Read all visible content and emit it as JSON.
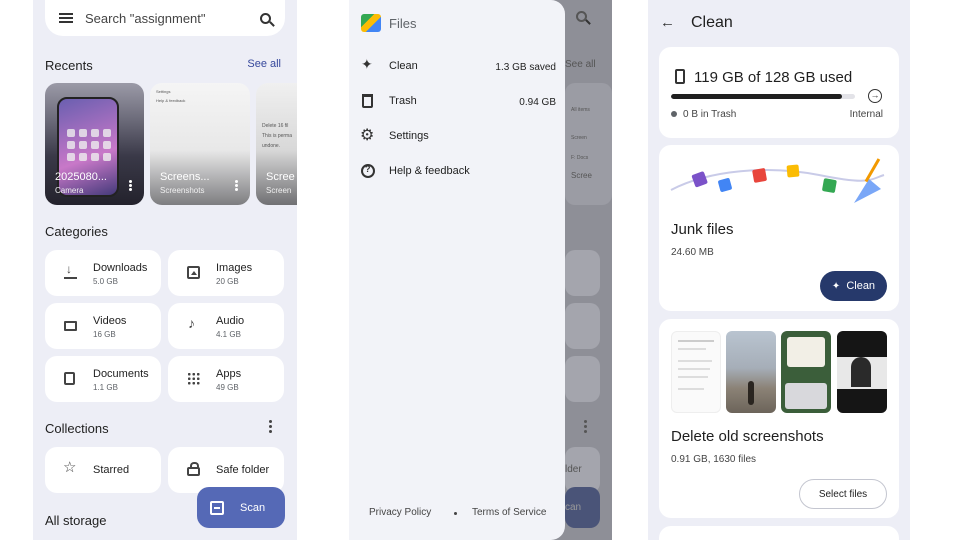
{
  "left": {
    "search_placeholder": "Search \"assignment\"",
    "recents_title": "Recents",
    "see_all": "See all",
    "recents": [
      {
        "title": "2025080...",
        "subtitle": "Camera"
      },
      {
        "title": "Screens...",
        "subtitle": "Screenshots"
      },
      {
        "title": "Scree",
        "subtitle": "Screen"
      }
    ],
    "mini_list": [
      "Settings",
      "Help & feedback"
    ],
    "third_thumb_text": [
      "Delete 16 fil",
      "This is perma",
      "undone."
    ],
    "categories_title": "Categories",
    "categories": [
      {
        "label": "Downloads",
        "size": "5.0 GB"
      },
      {
        "label": "Images",
        "size": "20 GB"
      },
      {
        "label": "Videos",
        "size": "16 GB"
      },
      {
        "label": "Audio",
        "size": "4.1 GB"
      },
      {
        "label": "Documents",
        "size": "1.1 GB"
      },
      {
        "label": "Apps",
        "size": "49 GB"
      }
    ],
    "collections_title": "Collections",
    "collections": [
      {
        "label": "Starred"
      },
      {
        "label": "Safe folder"
      }
    ],
    "all_storage_title": "All storage",
    "scan_label": "Scan"
  },
  "middle": {
    "app_name": "Files",
    "items": [
      {
        "label": "Clean",
        "value": "1.3 GB saved"
      },
      {
        "label": "Trash",
        "value": "0.94 GB"
      },
      {
        "label": "Settings",
        "value": ""
      },
      {
        "label": "Help & feedback",
        "value": ""
      }
    ],
    "privacy": "Privacy Policy",
    "terms": "Terms of Service",
    "ghost_see_all": "See all",
    "ghost_list": [
      "All items",
      "Screen",
      "F: Docs",
      "Screen"
    ],
    "ghost_scree": "Scree",
    "ghost_lder": "lder",
    "ghost_can": "can"
  },
  "right": {
    "title": "Clean",
    "storage_used": "119 GB of 128 GB used",
    "storage_fraction": 0.93,
    "trash": "0 B in Trash",
    "internal": "Internal",
    "junk_title": "Junk files",
    "junk_size": "24.60 MB",
    "clean_label": "Clean",
    "delete_title": "Delete old screenshots",
    "delete_sub": "0.91 GB, 1630 files",
    "select_label": "Select files"
  }
}
